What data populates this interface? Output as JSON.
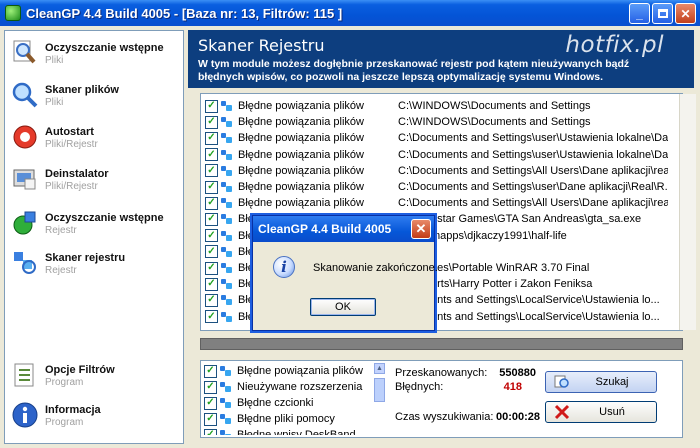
{
  "window": {
    "title": "CleanGP 4.4 Build 4005  - [Baza nr: 13, Filtrów: 115 ]"
  },
  "sidebar": {
    "items": [
      {
        "title": "Oczyszczanie wstępne",
        "subtitle": "Pliki"
      },
      {
        "title": "Skaner plików",
        "subtitle": "Pliki"
      },
      {
        "title": "Autostart",
        "subtitle": "Pliki/Rejestr"
      },
      {
        "title": "Deinstalator",
        "subtitle": "Pliki/Rejestr"
      },
      {
        "title": "Oczyszczanie wstępne",
        "subtitle": "Rejestr"
      },
      {
        "title": "Skaner rejestru",
        "subtitle": "Rejestr"
      }
    ],
    "bottom_items": [
      {
        "title": "Opcje Filtrów",
        "subtitle": "Program"
      },
      {
        "title": "Informacja",
        "subtitle": "Program"
      }
    ]
  },
  "header": {
    "title": "Skaner Rejestru",
    "description": "W tym module możesz dogłębnie przeskanować rejestr pod kątem nieużywanych bądź błędnych wpisów, co pozwoli na jeszcze lepszą optymalizację systemu Windows.",
    "watermark": "hotfix.pl"
  },
  "results": [
    {
      "category": "Błędne powiązania plików",
      "path": "C:\\WINDOWS\\Documents and Settings"
    },
    {
      "category": "Błędne powiązania plików",
      "path": "C:\\WINDOWS\\Documents and Settings"
    },
    {
      "category": "Błędne powiązania plików",
      "path": "C:\\Documents and Settings\\user\\Ustawienia lokalne\\Da..."
    },
    {
      "category": "Błędne powiązania plików",
      "path": "C:\\Documents and Settings\\user\\Ustawienia lokalne\\Da..."
    },
    {
      "category": "Błędne powiązania plików",
      "path": "C:\\Documents and Settings\\All Users\\Dane aplikacji\\rea..."
    },
    {
      "category": "Błędne powiązania plików",
      "path": "C:\\Documents and Settings\\user\\Dane aplikacji\\Real\\R..."
    },
    {
      "category": "Błędne powiązania plików",
      "path": "C:\\Documents and Settings\\All Users\\Dane aplikacji\\rea..."
    },
    {
      "category": "Błędne powiązania plików",
      "path": "D:\\Rockstar Games\\GTA San Andreas\\gta_sa.exe"
    },
    {
      "category": "Błę",
      "path": "...\\steamapps\\djkaczy1991\\half-life"
    },
    {
      "category": "Błę",
      "path": ""
    },
    {
      "category": "Błę",
      "path": "...am Files\\Portable WinRAR 3.70 Final"
    },
    {
      "category": "Błę",
      "path": "...onic Arts\\Harry Potter i Zakon Feniksa"
    },
    {
      "category": "Błę",
      "path": "...stuments and Settings\\LocalService\\Ustawienia lo..."
    },
    {
      "category": "Błę",
      "path": "...stuments and Settings\\LocalService\\Ustawienia lo..."
    }
  ],
  "categories": [
    "Błędne powiązania plików",
    "Nieużywane rozszerzenia",
    "Błędne czcionki",
    "Błędne pliki pomocy",
    "Błędne wpisy DeskBand..."
  ],
  "stats": {
    "scanned_label": "Przeskanowanych:",
    "scanned_value": "550880",
    "errors_label": "Błędnych:",
    "errors_value": "418",
    "time_label": "Czas wyszukiwania:",
    "time_value": "00:00:28"
  },
  "actions": {
    "search": "Szukaj",
    "delete": "Usuń"
  },
  "dialog": {
    "title": "CleanGP 4.4 Build 4005",
    "message": "Skanowanie zakończone.",
    "ok": "OK"
  },
  "colors": {
    "header_bg": "#0d3e7f",
    "errors_value": "#c00000"
  }
}
